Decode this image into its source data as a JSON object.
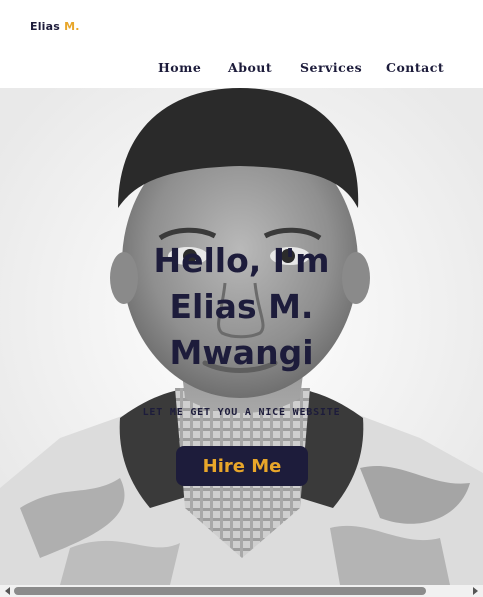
{
  "header": {
    "logo": {
      "name": "Elias",
      "accent": "M."
    },
    "nav": [
      {
        "label": "Home"
      },
      {
        "label": "About"
      },
      {
        "label": "Services"
      },
      {
        "label": "Contact"
      }
    ]
  },
  "hero": {
    "headline_lines": [
      "Hello, I'm",
      "Elias M.",
      "Mwangi"
    ],
    "tagline": "LET ME GET YOU A NICE WEBSITE",
    "cta_label": "Hire Me"
  },
  "colors": {
    "primary": "#1d1c3b",
    "accent": "#e8a62a",
    "background": "#ffffff"
  },
  "icons": {
    "scroll_left": "triangle-left-icon",
    "scroll_right": "triangle-right-icon"
  }
}
